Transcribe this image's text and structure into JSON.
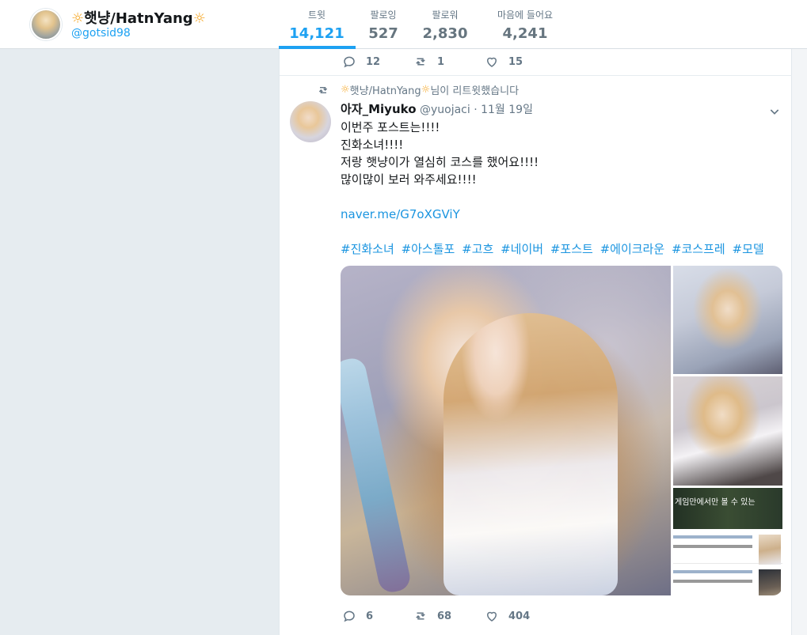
{
  "profile": {
    "name_prefix_icon": "☼",
    "name": "햇냥/HatnYang",
    "name_suffix_icon": "☼",
    "handle": "@gotsid98",
    "avatar_icon": "profile-avatar"
  },
  "stats": [
    {
      "label": "트윗",
      "value": "14,121",
      "active": true
    },
    {
      "label": "팔로잉",
      "value": "527",
      "active": false
    },
    {
      "label": "팔로워",
      "value": "2,830",
      "active": false
    },
    {
      "label": "마음에 들어요",
      "value": "4,241",
      "active": false
    }
  ],
  "prev_tweet_actions": {
    "replies": "12",
    "retweets": "1",
    "likes": "15"
  },
  "tweet": {
    "retweet_context": {
      "icon": "retweet-icon",
      "sun_left": "☼",
      "name": "햇냥/HatnYang",
      "sun_right": "☼",
      "suffix": " 님이 리트윗했습니다"
    },
    "author_name": "아자_Miyuko",
    "author_handle": "@yuojaci",
    "date": "· 11월 19일",
    "text_lines": [
      "이번주 포스트는!!!!",
      "진화소녀!!!!",
      "저랑 햇냥이가 열심히 코스를 했어요!!!!",
      "많이많이 보러 와주세요!!!!"
    ],
    "link": "naver.me/G7oXGViY",
    "hashtags": [
      "#진화소녀",
      "#아스톨포",
      "#고흐",
      "#네이버",
      "#포스트",
      "#에이크라운",
      "#코스프레",
      "#모델"
    ],
    "actions": {
      "replies": "6",
      "retweets": "68",
      "likes": "404"
    }
  },
  "photo_overlay_text": "게임만에서만 볼 수 있는",
  "colors": {
    "accent": "#1da1f2",
    "link": "#1b95e0",
    "muted": "#657786",
    "background": "#e6ecf0"
  }
}
